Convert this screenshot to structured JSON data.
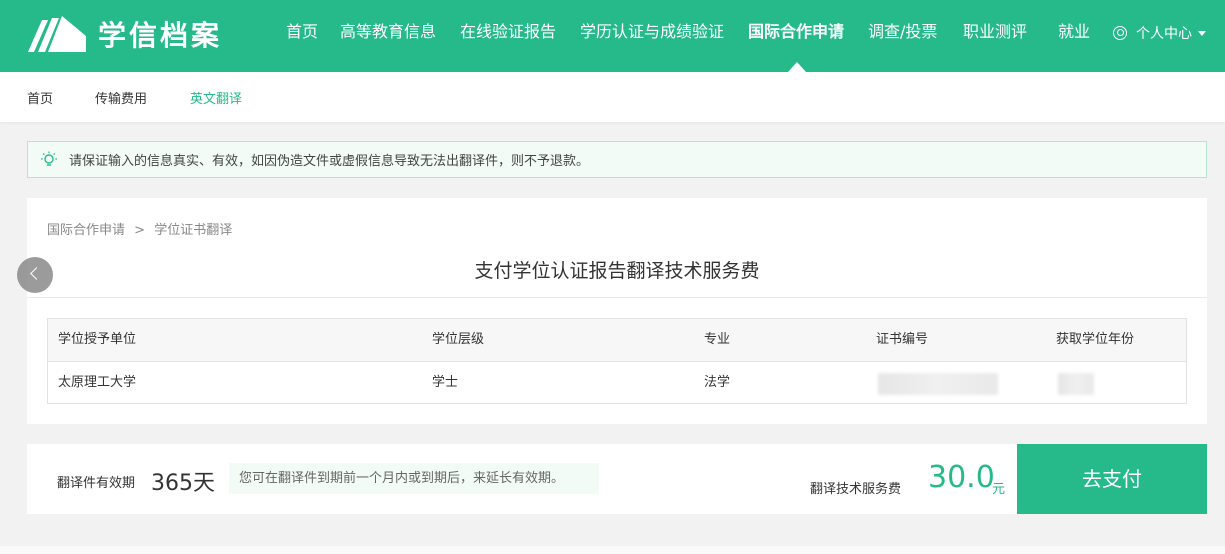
{
  "brand": {
    "name": "学信档案"
  },
  "nav": {
    "items": [
      {
        "label": "首页"
      },
      {
        "label": "高等教育信息"
      },
      {
        "label": "在线验证报告"
      },
      {
        "label": "学历认证与成绩验证"
      },
      {
        "label": "国际合作申请",
        "active": true
      },
      {
        "label": "调查/投票"
      },
      {
        "label": "职业测评"
      },
      {
        "label": "就业"
      }
    ],
    "user_center": "个人中心"
  },
  "subnav": {
    "items": [
      {
        "label": "首页"
      },
      {
        "label": "传输费用"
      },
      {
        "label": "英文翻译",
        "active": true
      }
    ]
  },
  "notice": {
    "text": "请保证输入的信息真实、有效，如因伪造文件或虚假信息导致无法出翻译件，则不予退款。"
  },
  "breadcrumb": {
    "parent": "国际合作申请",
    "separator": ">",
    "current": "学位证书翻译"
  },
  "card": {
    "title": "支付学位认证报告翻译技术服务费"
  },
  "table": {
    "headers": [
      "学位授予单位",
      "学位层级",
      "专业",
      "证书编号",
      "获取学位年份"
    ],
    "rows": [
      [
        "太原理工大学",
        "学士",
        "法学",
        "",
        ""
      ]
    ]
  },
  "payment": {
    "valid_label": "翻译件有效期",
    "valid_value": "365天",
    "valid_tip": "您可在翻译件到期前一个月内或到期后，来延长有效期。",
    "fee_label": "翻译技术服务费",
    "fee_value": "30.0",
    "fee_unit": "元",
    "pay_button": "去支付"
  },
  "colors": {
    "brand": "#26ba8a",
    "notice_bg": "#f3fbf7"
  }
}
